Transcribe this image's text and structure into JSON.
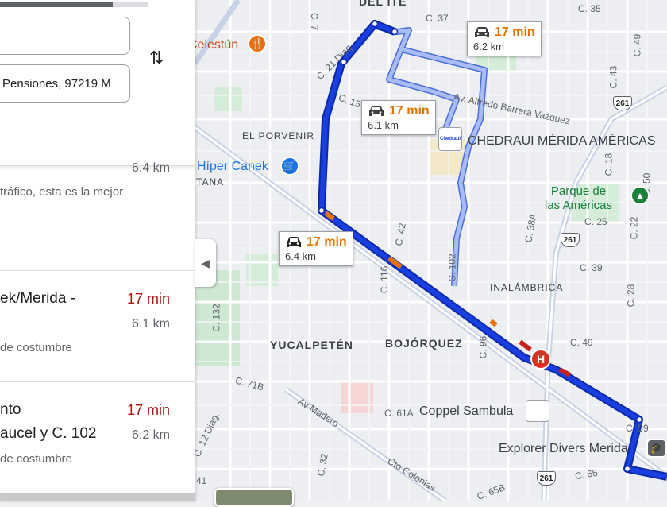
{
  "panel": {
    "destination_value": "Pensiones, 97219 M",
    "option1": {
      "dist": "6.4 km",
      "note": "tráfico, esta es la mejor"
    },
    "option2": {
      "title": "ek/Merida -",
      "time": "17 min",
      "dist": "6.1 km",
      "note": "de costumbre"
    },
    "option3": {
      "title_line1": "nto",
      "title_line2": "aucel y C. 102",
      "time": "17 min",
      "dist": "6.2 km",
      "note": "de costumbre"
    }
  },
  "map": {
    "route_cards": [
      {
        "time": "17 min",
        "dist": "6.2 km",
        "icon": "car-icon"
      },
      {
        "time": "17 min",
        "dist": "6.1 km",
        "icon": "car-icon"
      },
      {
        "time": "17 min",
        "dist": "6.4 km",
        "icon": "car-icon"
      }
    ],
    "places": {
      "celestun": "Celestún",
      "hiper_canek": "Híper Canek",
      "chedraui": "CHEDRAUI MÉRIDA AMÉRICAS",
      "chedraui_logo": "Chedraui",
      "parque_line1": "Parque de",
      "parque_line2": "las Américas",
      "coppel": "Coppel Sambula",
      "explorer": "Explorer Divers Merida",
      "hospital": "H"
    },
    "districts": {
      "el_porvenir": "EL PORVENIR",
      "tana": "TANA",
      "inalambrica": "INALÁMBRICA",
      "yucalpeten": "YUCALPETÉN",
      "bojorquez": "BOJÓRQUEZ",
      "top_partial": "DEL ITE"
    },
    "streets": {
      "c7": "C. 7",
      "c37": "C. 37",
      "c35": "C. 35",
      "c21diag": "C. 21 Diag.",
      "c15": "C. 15",
      "c43": "C. 43",
      "c49top": "C. 49",
      "av_alfredo": "Av. Alfredo Barrera Vazquez",
      "c18": "C. 18",
      "c25": "C. 25",
      "c22": "C. 22",
      "c42": "C. 42",
      "c102": "C. 102",
      "c116": "C. 116",
      "c132": "C. 132",
      "c384": "C. 38A",
      "c39": "C. 39",
      "c28": "C. 28",
      "c96": "C. 96",
      "c49": "C. 49",
      "c71b": "C. 71B",
      "c61a": "C. 61A",
      "c59": "C. 59",
      "c12diag": "C. 12 Diag.",
      "av_madero": "Av Madero",
      "c32": "C. 32",
      "cto_colonias": "Cto Colonias",
      "c65": "C. 65",
      "c65b": "C. 65B",
      "c41": "41",
      "c50": "C. 50"
    },
    "shields": [
      "261",
      "261",
      "261"
    ]
  },
  "colors": {
    "route_selected": "#1a3fe0",
    "route_alt": "#8fa6f0",
    "time_orange": "#e37400",
    "time_red": "#b31412"
  }
}
